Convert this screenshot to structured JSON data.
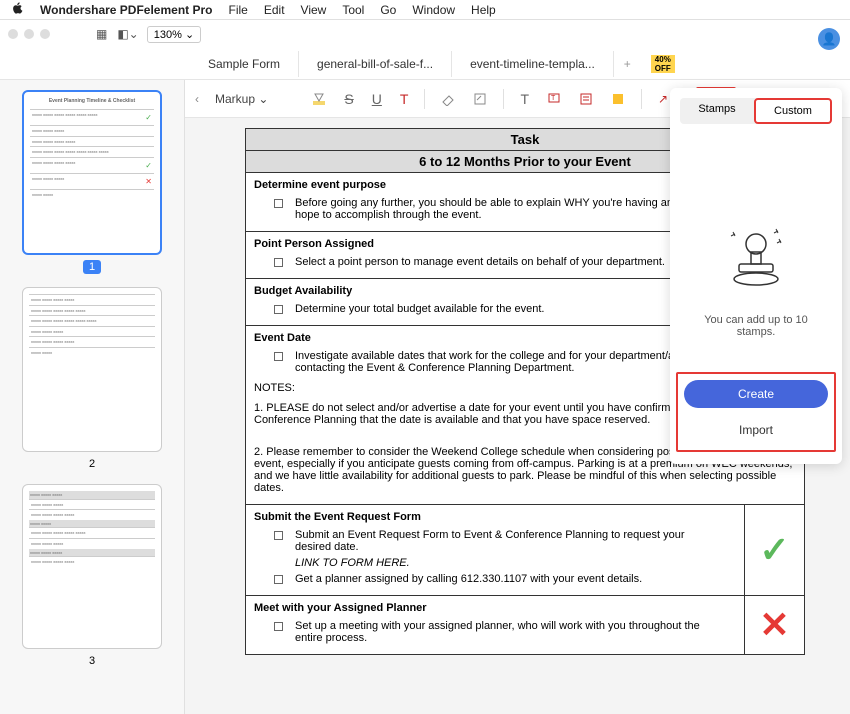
{
  "menubar": {
    "app": "Wondershare PDFelement Pro",
    "items": [
      "File",
      "Edit",
      "View",
      "Tool",
      "Go",
      "Window",
      "Help"
    ]
  },
  "zoom": "130% ⌄",
  "tabs": {
    "t1": "Sample Form",
    "t2": "general-bill-of-sale-f...",
    "t3": "event-timeline-templa..."
  },
  "markup": {
    "back": "‹",
    "label": "Markup ⌄"
  },
  "pages": {
    "p1": "1",
    "p2": "2",
    "p3": "3"
  },
  "doc": {
    "task_header": "Task",
    "subheader": "6 to 12 Months Prior to your Event",
    "sec1": {
      "title": "Determine event purpose",
      "b1": "Before going any further, you should be able to explain WHY you're having an event and what you hope to accomplish through the event."
    },
    "sec2": {
      "title": "Point Person Assigned",
      "b1": "Select a point person to manage event details on behalf of your department."
    },
    "sec3": {
      "title": "Budget Availability",
      "b1": "Determine your total budget available for the event."
    },
    "sec4": {
      "title": "Event Date",
      "b1": "Investigate available dates that work for the college and for your department/attendees by contacting the Event & Conference Planning Department.",
      "notes_label": "NOTES:",
      "n1": "1.  PLEASE do not select and/or advertise a date for your event until you have confirmed with Event & Conference Planning that the date is available and that you have space reserved.",
      "n2": "2.  Please remember to consider the Weekend College schedule when considering possible dates for your event, especially if you anticipate guests coming from off-campus.  Parking is at a premium on WEC weekends, and we have little availability for additional guests to park.  Please be mindful of this when selecting possible dates."
    },
    "sec5": {
      "title": "Submit the Event Request Form",
      "b1": "Submit an Event Request Form to Event & Conference Planning to request your desired date.",
      "link": "LINK TO FORM HERE.",
      "b2": "Get a planner assigned by calling 612.330.1107 with your event details."
    },
    "sec6": {
      "title": "Meet with your Assigned Planner",
      "b1": "Set up a meeting with your assigned planner, who will work with you throughout the entire process."
    }
  },
  "stamp": {
    "tab1": "Stamps",
    "tab2": "Custom",
    "msg": "You can add up to 10 stamps.",
    "create": "Create",
    "import": "Import"
  }
}
